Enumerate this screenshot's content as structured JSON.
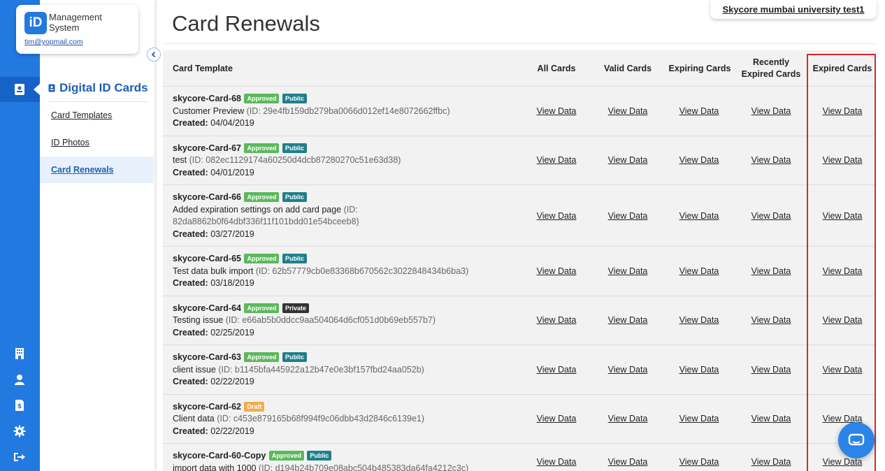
{
  "brand": {
    "logo": "iD",
    "name_line1": "Management",
    "name_line2": "System",
    "email": "tim@yopmail.com"
  },
  "rail_icons": [
    "id-card-icon",
    "building-icon",
    "user-icon",
    "invoice-icon",
    "gear-icon",
    "sign-out-icon"
  ],
  "sidebar": {
    "section_title": "Digital ID Cards",
    "items": [
      {
        "label": "Card Templates",
        "active": false
      },
      {
        "label": "ID Photos",
        "active": false
      },
      {
        "label": "Card Renewals",
        "active": true
      }
    ]
  },
  "page": {
    "title": "Card Renewals",
    "organization": "Skycore mumbai university test1"
  },
  "table": {
    "columns": {
      "template": "Card Template",
      "all": "All Cards",
      "valid": "Valid Cards",
      "expiring": "Expiring Cards",
      "recent1": "Recently",
      "recent2": "Expired Cards",
      "expired": "Expired Cards"
    },
    "link_label": "View Data",
    "created_label": "Created:",
    "rows": [
      {
        "name": "skycore-Card-68",
        "badges": [
          {
            "text": "Approved",
            "kind": "approved"
          },
          {
            "text": "Public",
            "kind": "public"
          }
        ],
        "desc": "Customer Preview",
        "id": "(ID: 29e4fb159db279ba0066d012ef14e8072662ffbc)",
        "created": "04/04/2019"
      },
      {
        "name": "skycore-Card-67",
        "badges": [
          {
            "text": "Approved",
            "kind": "approved"
          },
          {
            "text": "Public",
            "kind": "public"
          }
        ],
        "desc": "test",
        "id": "(ID: 082ec1129174a60250d4dcb87280270c51e63d38)",
        "created": "04/01/2019"
      },
      {
        "name": "skycore-Card-66",
        "badges": [
          {
            "text": "Approved",
            "kind": "approved"
          },
          {
            "text": "Public",
            "kind": "public"
          }
        ],
        "desc": "Added expiration settings on add card page",
        "id": "(ID: 82da8862b0f64dbf336f11f101bdd01e54bceeb8)",
        "created": "03/27/2019"
      },
      {
        "name": "skycore-Card-65",
        "badges": [
          {
            "text": "Approved",
            "kind": "approved"
          },
          {
            "text": "Public",
            "kind": "public"
          }
        ],
        "desc": "Test data bulk import",
        "id": "(ID: 62b57779cb0e83368b670562c3022848434b6ba3)",
        "created": "03/18/2019"
      },
      {
        "name": "skycore-Card-64",
        "badges": [
          {
            "text": "Approved",
            "kind": "approved"
          },
          {
            "text": "Private",
            "kind": "private"
          }
        ],
        "desc": "Testing issue",
        "id": "(ID: e66ab5b0ddcc9aa504064d6cf051d0b69eb557b7)",
        "created": "02/25/2019"
      },
      {
        "name": "skycore-Card-63",
        "badges": [
          {
            "text": "Approved",
            "kind": "approved"
          },
          {
            "text": "Public",
            "kind": "public"
          }
        ],
        "desc": "client issue",
        "id": "(ID: b1145bfa445922a12b47e0e3bf157fbd24aa052b)",
        "created": "02/22/2019"
      },
      {
        "name": "skycore-Card-62",
        "badges": [
          {
            "text": "Draft",
            "kind": "draft"
          }
        ],
        "desc": "Client data",
        "id": "(ID: c453e879165b68f994f9c06dbb43d2846c6139e1)",
        "created": "02/22/2019"
      },
      {
        "name": "skycore-Card-60-Copy",
        "badges": [
          {
            "text": "Approved",
            "kind": "approved"
          },
          {
            "text": "Public",
            "kind": "public"
          }
        ],
        "desc": "import data with 1000",
        "id": "(ID: d194b24b709e08abc504b485383da64fa4212c3c)",
        "created": ""
      }
    ]
  },
  "colors": {
    "rail": "#2279e0",
    "accent": "#1e5fb4",
    "highlight": "#d9262c"
  }
}
